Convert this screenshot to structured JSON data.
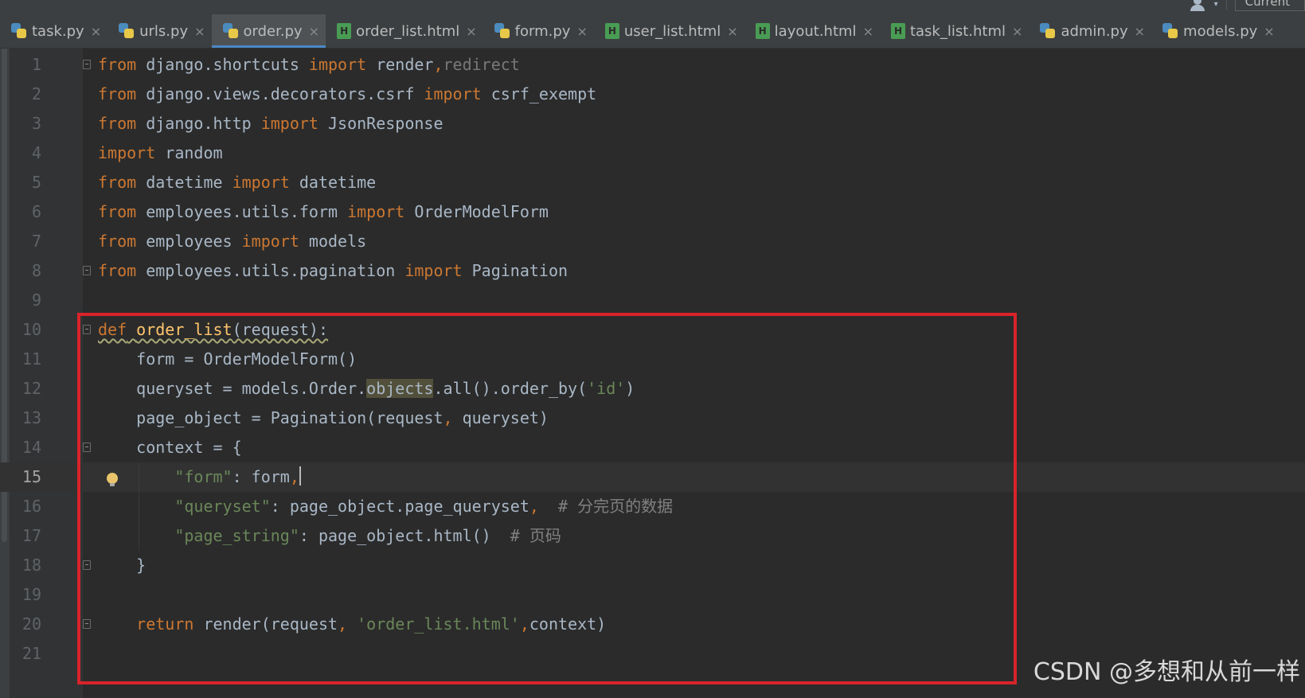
{
  "top_right": {
    "partial_text": "Current"
  },
  "tabs": [
    {
      "label": "task.py",
      "type": "py"
    },
    {
      "label": "urls.py",
      "type": "py"
    },
    {
      "label": "order.py",
      "type": "py",
      "active": true
    },
    {
      "label": "order_list.html",
      "type": "html"
    },
    {
      "label": "form.py",
      "type": "py"
    },
    {
      "label": "user_list.html",
      "type": "html"
    },
    {
      "label": "layout.html",
      "type": "html"
    },
    {
      "label": "task_list.html",
      "type": "html"
    },
    {
      "label": "admin.py",
      "type": "py"
    },
    {
      "label": "models.py",
      "type": "py"
    }
  ],
  "tab_close_glyph": "×",
  "editor": {
    "current_line": 15,
    "lines": [
      {
        "num": "1",
        "text": "from django.shortcuts import render,redirect"
      },
      {
        "num": "2",
        "text": "from django.views.decorators.csrf import csrf_exempt"
      },
      {
        "num": "3",
        "text": "from django.http import JsonResponse"
      },
      {
        "num": "4",
        "text": "import random"
      },
      {
        "num": "5",
        "text": "from datetime import datetime"
      },
      {
        "num": "6",
        "text": "from employees.utils.form import OrderModelForm"
      },
      {
        "num": "7",
        "text": "from employees import models"
      },
      {
        "num": "8",
        "text": "from employees.utils.pagination import Pagination"
      },
      {
        "num": "9",
        "text": ""
      },
      {
        "num": "10",
        "text": "def order_list(request):"
      },
      {
        "num": "11",
        "text": "    form = OrderModelForm()"
      },
      {
        "num": "12",
        "text": "    queryset = models.Order.objects.all().order_by('id')"
      },
      {
        "num": "13",
        "text": "    page_object = Pagination(request, queryset)"
      },
      {
        "num": "14",
        "text": "    context = {"
      },
      {
        "num": "15",
        "text": "        \"form\": form,"
      },
      {
        "num": "16",
        "text": "        \"queryset\": page_object.page_queryset,  # 分完页的数据"
      },
      {
        "num": "17",
        "text": "        \"page_string\": page_object.html()  # 页码"
      },
      {
        "num": "18",
        "text": "    }"
      },
      {
        "num": "19",
        "text": ""
      },
      {
        "num": "20",
        "text": "    return render(request, 'order_list.html',context)"
      },
      {
        "num": "21",
        "text": ""
      }
    ]
  },
  "watermark": "CSDN @多想和从前一样",
  "colors": {
    "background": "#2b2b2b",
    "keyword": "#cc7832",
    "function": "#ffc66d",
    "string": "#6a8759",
    "comment": "#808080",
    "highlight_box": "#d9232a"
  }
}
